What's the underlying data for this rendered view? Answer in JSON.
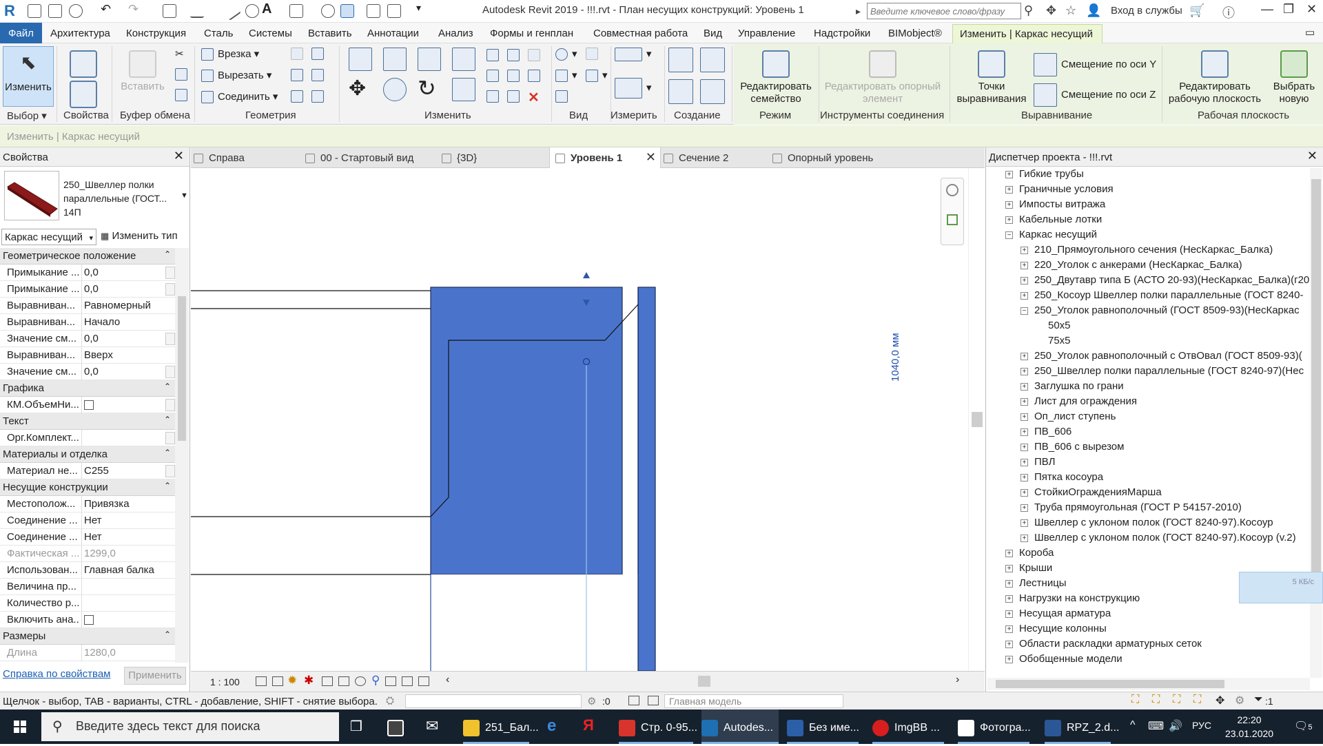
{
  "app": {
    "title": "Autodesk Revit 2019 - !!!.rvt - План несущих конструкций: Уровень 1",
    "search_placeholder": "Введите ключевое слово/фразу",
    "login": "Вход в службы",
    "window_controls": [
      "—",
      "❐",
      "✕"
    ]
  },
  "menu": {
    "file": "Файл",
    "items": [
      "Архитектура",
      "Конструкция",
      "Сталь",
      "Системы",
      "Вставить",
      "Аннотации",
      "Анализ",
      "Формы и генплан",
      "Совместная работа",
      "Вид",
      "Управление",
      "Надстройки",
      "BIMobject®"
    ],
    "active_context": "Изменить | Каркас несущий"
  },
  "ribbon": {
    "modify": "Изменить",
    "select_group": "Выбор",
    "properties_group": "Свойства",
    "paste": "Вставить",
    "clipboard_group": "Буфер обмена",
    "cut_in": "Врезка",
    "cut_out": "Вырезать",
    "join": "Соединить",
    "geometry_group": "Геометрия",
    "modify_group": "Изменить",
    "view_group": "Вид",
    "measure_group": "Измерить",
    "create_group": "Создание",
    "edit_family": "Редактировать семейство",
    "mode_group": "Режим",
    "edit_ref": "Редактировать опорный элемент",
    "join_tools_group": "Инструменты соединения",
    "align_points": "Точки выравнивания",
    "offset_y": "Смещение по оси Y",
    "offset_z": "Смещение по оси Z",
    "align_group": "Выравнивание",
    "edit_workplane": "Редактировать рабочую плоскость",
    "workplane_group": "Рабочая плоскость",
    "pick_new": "Выбрать новую"
  },
  "options_bar": {
    "text": "Изменить | Каркас несущий"
  },
  "properties": {
    "title": "Свойства",
    "type_name": "250_Швеллер полки параллельные (ГОСТ... 14П",
    "filter": "Каркас несущий",
    "edit_type": "Изменить тип",
    "help": "Справка по свойствам",
    "apply": "Применить",
    "geom_cat": "Геометрическое положение",
    "graphics_cat": "Графика",
    "text_cat": "Текст",
    "mat_cat": "Материалы и отделка",
    "struct_cat": "Несущие конструкции",
    "dims_cat": "Размеры",
    "r1k": "Примыкание ...",
    "r1v": "0,0",
    "r2k": "Примыкание ...",
    "r2v": "0,0",
    "r3k": "Выравниван...",
    "r3v": "Равномерный",
    "r4k": "Выравниван...",
    "r4v": "Начало",
    "r5k": "Значение см...",
    "r5v": "0,0",
    "r6k": "Выравниван...",
    "r6v": "Вверх",
    "r7k": "Значение см...",
    "r7v": "0,0",
    "g1k": "КМ.ОбъемНи...",
    "t1k": "Орг.Комплект...",
    "t1v": "",
    "m1k": "Материал не...",
    "m1v": "C255",
    "s1k": "Местополож...",
    "s1v": "Привязка",
    "s2k": "Соединение ...",
    "s2v": "Нет",
    "s3k": "Соединение ...",
    "s3v": "Нет",
    "s4k": "Фактическая ...",
    "s4v": "1299,0",
    "s5k": "Использован...",
    "s5v": "Главная балка",
    "s6k": "Величина пр...",
    "s6v": "",
    "s7k": "Количество р...",
    "s7v": "",
    "s8k": "Включить ана...",
    "d1k": "Длина",
    "d1v": "1280,0"
  },
  "tabs": [
    {
      "label": "Справа",
      "active": false
    },
    {
      "label": "00 - Стартовый вид",
      "active": false
    },
    {
      "label": "{3D}",
      "active": false
    },
    {
      "label": "Уровень 1",
      "active": true
    },
    {
      "label": "Сечение 2",
      "active": false
    },
    {
      "label": "Опорный уровень",
      "active": false
    }
  ],
  "canvas": {
    "dimension": "1040,0 мм",
    "element_fill": "#4a74cc",
    "scale": "1 : 100"
  },
  "browser": {
    "title": "Диспетчер проекта - !!!.rvt",
    "net_widget": "5 КБ/с"
  },
  "tree": [
    {
      "label": "Гибкие трубы",
      "level": 1,
      "sign": "+"
    },
    {
      "label": "Граничные условия",
      "level": 1,
      "sign": "+"
    },
    {
      "label": "Импосты витража",
      "level": 1,
      "sign": "+"
    },
    {
      "label": "Кабельные лотки",
      "level": 1,
      "sign": "+"
    },
    {
      "label": "Каркас несущий",
      "level": 1,
      "sign": "−"
    },
    {
      "label": "210_Прямоугольного сечения (НесКаркас_Балка)",
      "level": 2,
      "sign": "+"
    },
    {
      "label": "220_Уголок с анкерами (НесКаркас_Балка)",
      "level": 2,
      "sign": "+"
    },
    {
      "label": "250_Двутавр типа Б (АСТО 20-93)(НесКаркас_Балка)(г20",
      "level": 2,
      "sign": "+"
    },
    {
      "label": "250_Косоур Швеллер полки параллельные (ГОСТ 8240-",
      "level": 2,
      "sign": "+"
    },
    {
      "label": "250_Уголок равнополочный (ГОСТ 8509-93)(НесКаркас",
      "level": 2,
      "sign": "−"
    },
    {
      "label": "50x5",
      "level": 3,
      "sign": ""
    },
    {
      "label": "75x5",
      "level": 3,
      "sign": ""
    },
    {
      "label": "250_Уголок равнополочный с ОтвОвал (ГОСТ 8509-93)(",
      "level": 2,
      "sign": "+"
    },
    {
      "label": "250_Швеллер полки параллельные (ГОСТ 8240-97)(Нес",
      "level": 2,
      "sign": "+"
    },
    {
      "label": "Заглушка по грани",
      "level": 2,
      "sign": "+"
    },
    {
      "label": "Лист для ограждения",
      "level": 2,
      "sign": "+"
    },
    {
      "label": "Оп_лист ступень",
      "level": 2,
      "sign": "+"
    },
    {
      "label": "ПВ_606",
      "level": 2,
      "sign": "+"
    },
    {
      "label": "ПВ_606 с вырезом",
      "level": 2,
      "sign": "+"
    },
    {
      "label": "ПВЛ",
      "level": 2,
      "sign": "+"
    },
    {
      "label": "Пятка косоура",
      "level": 2,
      "sign": "+"
    },
    {
      "label": "СтойкиОгражденияМарша",
      "level": 2,
      "sign": "+"
    },
    {
      "label": "Труба прямоугольная (ГОСТ Р 54157-2010)",
      "level": 2,
      "sign": "+"
    },
    {
      "label": "Швеллер с уклоном полок (ГОСТ 8240-97).Косоур",
      "level": 2,
      "sign": "+"
    },
    {
      "label": "Швеллер с уклоном полок (ГОСТ 8240-97).Косоур (v.2)",
      "level": 2,
      "sign": "+"
    },
    {
      "label": "Короба",
      "level": 1,
      "sign": "+"
    },
    {
      "label": "Крыши",
      "level": 1,
      "sign": "+"
    },
    {
      "label": "Лестницы",
      "level": 1,
      "sign": "+"
    },
    {
      "label": "Нагрузки на конструкцию",
      "level": 1,
      "sign": "+"
    },
    {
      "label": "Несущая арматура",
      "level": 1,
      "sign": "+"
    },
    {
      "label": "Несущие колонны",
      "level": 1,
      "sign": "+"
    },
    {
      "label": "Области раскладки арматурных сеток",
      "level": 1,
      "sign": "+"
    },
    {
      "label": "Обобщенные модели",
      "level": 1,
      "sign": "+"
    }
  ],
  "status": {
    "hint": "Щелчок - выбор, TAB - варианты, CTRL - добавление, SHIFT - снятие выбора.",
    "zero": ":0",
    "model": "Главная модель",
    "filter_count": ":1"
  },
  "taskbar": {
    "search": "Введите здесь текст для поиска",
    "apps": [
      {
        "label": "251_Бал...",
        "color": "#f2c12e"
      },
      {
        "label": "Стр. 0-95...",
        "color": "#d9342b"
      },
      {
        "label": "Autodes...",
        "color": "#1f6fb3"
      },
      {
        "label": "Без име...",
        "color": "#2b5fa8"
      },
      {
        "label": "ImgBB ...",
        "color": "#d81e1e"
      },
      {
        "label": "Фотогра...",
        "color": "#ffffff"
      },
      {
        "label": "RPZ_2.d...",
        "color": "#2b5797"
      }
    ],
    "lang": "РУС",
    "time": "22:20",
    "date": "23.01.2020",
    "notif": "5"
  }
}
